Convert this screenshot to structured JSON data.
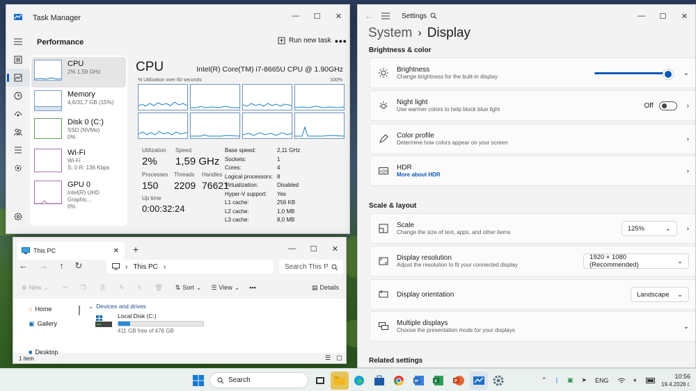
{
  "task_manager": {
    "title": "Task Manager",
    "section": "Performance",
    "run_new_task": "Run new task",
    "more": "•••",
    "resources": [
      {
        "name": "CPU",
        "sub1": "2% 1,59 GHz",
        "sub2": ""
      },
      {
        "name": "Memory",
        "sub1": "4,6/31,7 GB (15%)",
        "sub2": ""
      },
      {
        "name": "Disk 0 (C:)",
        "sub1": "SSD (NVMe)",
        "sub2": "0%"
      },
      {
        "name": "Wi-Fi",
        "sub1": "Wi-Fi",
        "sub2": "S: 0 R: 136 Kbps"
      },
      {
        "name": "GPU 0",
        "sub1": "Intel(R) UHD Graphic...",
        "sub2": "0%"
      }
    ],
    "cpu": {
      "heading": "CPU",
      "model": "Intel(R) Core(TM) i7-8665U CPU @ 1.90GHz",
      "util_label": "% Utilization over 60 seconds",
      "util_max": "100%",
      "stats": {
        "utilization_label": "Utilization",
        "utilization": "2%",
        "speed_label": "Speed",
        "speed": "1,59 GHz",
        "processes_label": "Processes",
        "processes": "150",
        "threads_label": "Threads",
        "threads": "2209",
        "handles_label": "Handles",
        "handles": "76621",
        "uptime_label": "Up time",
        "uptime": "0:00:32:24"
      },
      "details": [
        {
          "k": "Base speed:",
          "v": "2,11 GHz"
        },
        {
          "k": "Sockets:",
          "v": "1"
        },
        {
          "k": "Cores:",
          "v": "4"
        },
        {
          "k": "Logical processors:",
          "v": "8"
        },
        {
          "k": "Virtualization:",
          "v": "Disabled"
        },
        {
          "k": "Hyper-V support:",
          "v": "Yes"
        },
        {
          "k": "L1 cache:",
          "v": "256 KB"
        },
        {
          "k": "L2 cache:",
          "v": "1,0 MB"
        },
        {
          "k": "L3 cache:",
          "v": "8,0 MB"
        }
      ]
    }
  },
  "explorer": {
    "tab_title": "This PC",
    "address": "This PC",
    "search_placeholder": "Search This P",
    "toolbar": {
      "new": "New",
      "sort": "Sort",
      "view": "View",
      "more": "•••",
      "details": "Details"
    },
    "nav": [
      {
        "label": "Home"
      },
      {
        "label": "Gallery"
      },
      {
        "label": "Desktop"
      }
    ],
    "group_label": "Devices and drives",
    "drive": {
      "name": "Local Disk (C:)",
      "free_text": "411 GB free of 476 GB",
      "used_fraction": 0.136
    },
    "status": "1 item"
  },
  "settings": {
    "title": "Settings",
    "breadcrumb_parent": "System",
    "breadcrumb_sep": "›",
    "breadcrumb_current": "Display",
    "section1": "Brightness & color",
    "section2": "Scale & layout",
    "section3": "Related settings",
    "brightness": {
      "title": "Brightness",
      "desc": "Change brightness for the built-in display",
      "value_fraction": 1.0
    },
    "night_light": {
      "title": "Night light",
      "desc": "Use warmer colors to help block blue light",
      "state": "Off"
    },
    "color_profile": {
      "title": "Color profile",
      "desc": "Determine how colors appear on your screen"
    },
    "hdr": {
      "title": "HDR",
      "link": "More about HDR"
    },
    "scale": {
      "title": "Scale",
      "desc": "Change the size of text, apps, and other items",
      "value": "125%"
    },
    "resolution": {
      "title": "Display resolution",
      "desc": "Adjust the resolution to fit your connected display",
      "value": "1920 × 1080 (Recommended)"
    },
    "orientation": {
      "title": "Display orientation",
      "value": "Landscape"
    },
    "multiple": {
      "title": "Multiple displays",
      "desc": "Choose the presentation mode for your displays"
    }
  },
  "taskbar": {
    "search_label": "Search",
    "language": "ENG",
    "time": "10:56",
    "date": "19.4.2026 г."
  },
  "colors": {
    "accent": "#0b57b9",
    "cpu_graph": "#1a7fc1"
  }
}
